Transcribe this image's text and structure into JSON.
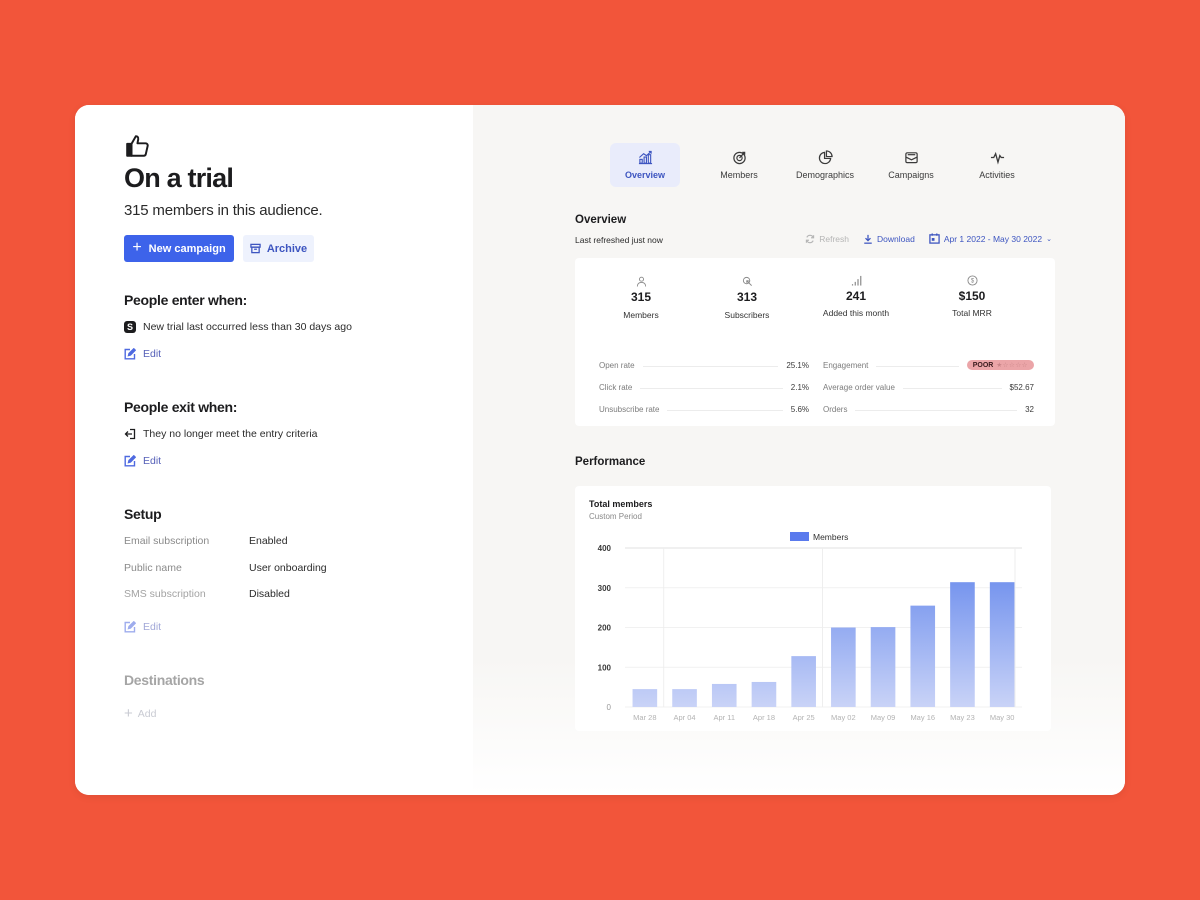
{
  "audience": {
    "icon": "thumbs-up-icon",
    "title": "On a trial",
    "subtitle": "315 members in this audience.",
    "new_campaign_label": "New campaign",
    "archive_label": "Archive"
  },
  "entry": {
    "heading": "People enter when:",
    "rule": "New trial last occurred less than 30 days ago",
    "rule_icon_letter": "S",
    "edit_label": "Edit"
  },
  "exit": {
    "heading": "People exit when:",
    "rule": "They no longer meet the entry criteria",
    "edit_label": "Edit"
  },
  "setup": {
    "heading": "Setup",
    "rows": [
      {
        "key": "Email subscription",
        "value": "Enabled"
      },
      {
        "key": "Public name",
        "value": "User onboarding"
      },
      {
        "key": "SMS subscription",
        "value": "Disabled"
      }
    ],
    "edit_label": "Edit"
  },
  "destinations": {
    "heading": "Destinations",
    "add_label": "Add"
  },
  "tabs": [
    {
      "label": "Overview",
      "icon": "bar-chart-icon",
      "active": true
    },
    {
      "label": "Members",
      "icon": "target-icon",
      "active": false
    },
    {
      "label": "Demographics",
      "icon": "pie-chart-icon",
      "active": false
    },
    {
      "label": "Campaigns",
      "icon": "inbox-icon",
      "active": false
    },
    {
      "label": "Activities",
      "icon": "activity-icon",
      "active": false
    }
  ],
  "overview": {
    "title": "Overview",
    "last_refreshed": "Last refreshed just now",
    "refresh_label": "Refresh",
    "download_label": "Download",
    "date_range": "Apr 1 2022 - May 30 2022",
    "stats": [
      {
        "value": "315",
        "label": "Members",
        "icon": "user-icon"
      },
      {
        "value": "313",
        "label": "Subscribers",
        "icon": "cursor-click-icon"
      },
      {
        "value": "241",
        "label": "Added this month",
        "icon": "signal-bars-icon"
      },
      {
        "value": "$150",
        "label": "Total MRR",
        "icon": "dollar-circle-icon"
      }
    ],
    "metrics_left": [
      {
        "key": "Open rate",
        "value": "25.1%"
      },
      {
        "key": "Click rate",
        "value": "2.1%"
      },
      {
        "key": "Unsubscribe rate",
        "value": "5.6%"
      }
    ],
    "metrics_right": [
      {
        "key": "Engagement",
        "badge": "POOR",
        "stars": "★☆☆☆☆",
        "rating": 1,
        "rating_max": 5
      },
      {
        "key": "Average order value",
        "value": "$52.67"
      },
      {
        "key": "Orders",
        "value": "32"
      }
    ]
  },
  "performance": {
    "title": "Performance"
  },
  "colors": {
    "background": "#f2553a",
    "accent": "#3d63ea",
    "bar_top": "#7594ee",
    "bar_bottom": "#c9d3f7",
    "poor_badge": "#eba5a8"
  },
  "chart_data": {
    "type": "bar",
    "title": "Total members",
    "subtitle": "Custom Period",
    "legend": [
      "Members"
    ],
    "legend_position": "top-center",
    "categories": [
      "Mar 28",
      "Apr 04",
      "Apr 11",
      "Apr 18",
      "Apr 25",
      "May 02",
      "May 09",
      "May 16",
      "May 23",
      "May 30"
    ],
    "series": [
      {
        "name": "Members",
        "values": [
          45,
          45,
          58,
          63,
          128,
          200,
          201,
          255,
          314,
          314
        ]
      }
    ],
    "yticks": [
      0,
      100,
      200,
      300,
      400
    ],
    "ylim": [
      0,
      400
    ],
    "xlabel": "",
    "ylabel": "",
    "grid": true
  }
}
